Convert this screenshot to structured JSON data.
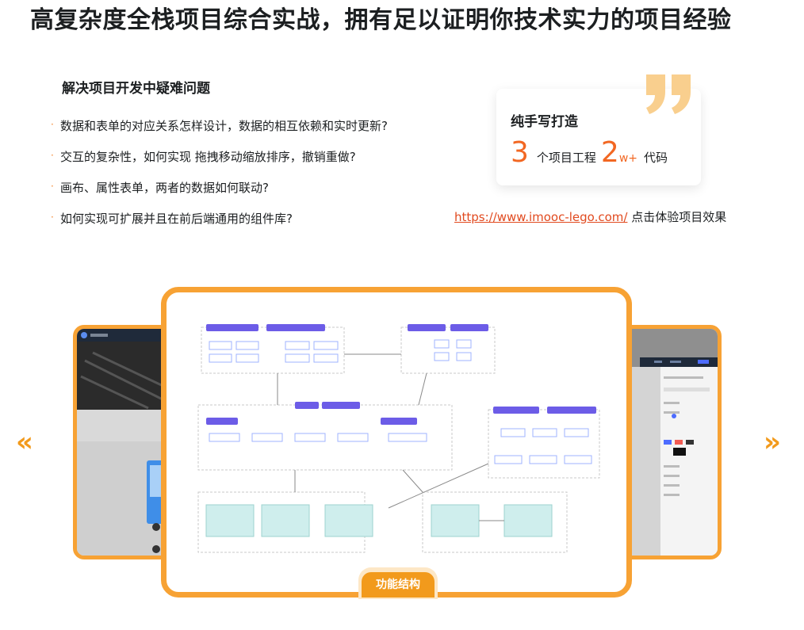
{
  "headline": "高复杂度全栈项目综合实战，拥有足以证明你技术实力的项目经验",
  "problems": {
    "title": "解决项目开发中疑难问题",
    "bullet": "·",
    "items": [
      "数据和表单的对应关系怎样设计，数据的相互依赖和实时更新?",
      "交互的复杂性，如何实现 拖拽移动缩放排序，撤销重做?",
      "画布、属性表单，两者的数据如何联动?",
      "如何实现可扩展并且在前后端通用的组件库?"
    ]
  },
  "card": {
    "title": "纯手写打造",
    "projects_count": "3",
    "projects_label": "个项目工程",
    "code_count": "2",
    "code_unit": "w+",
    "code_label": "代码"
  },
  "lego": {
    "link": "https://www.imooc-lego.com/",
    "suffix": "点击体验项目效果"
  },
  "carousel": {
    "prev": "«",
    "next": "»",
    "caption": "功能结构"
  },
  "colors": {
    "accent": "#f29a1c",
    "frame": "#f7a234",
    "number": "#f26722",
    "link": "#e14a1f"
  }
}
